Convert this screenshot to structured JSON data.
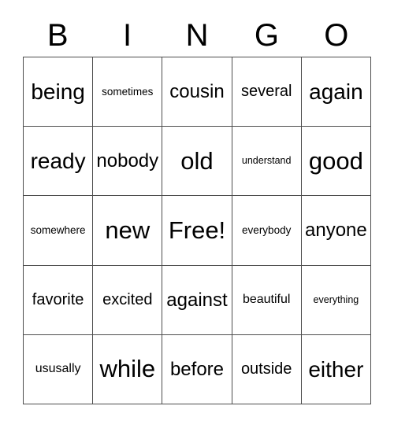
{
  "card": {
    "header_letters": [
      "B",
      "I",
      "N",
      "G",
      "O"
    ],
    "grid_rows": [
      [
        {
          "text": "being",
          "size": "lg"
        },
        {
          "text": "sometimes",
          "size": "xxs"
        },
        {
          "text": "cousin",
          "size": "md"
        },
        {
          "text": "several",
          "size": "sm"
        },
        {
          "text": "again",
          "size": "lg"
        }
      ],
      [
        {
          "text": "ready",
          "size": "lg"
        },
        {
          "text": "nobody",
          "size": "md"
        },
        {
          "text": "old",
          "size": "xl"
        },
        {
          "text": "understand",
          "size": "tiny"
        },
        {
          "text": "good",
          "size": "xl"
        }
      ],
      [
        {
          "text": "somewhere",
          "size": "xxs"
        },
        {
          "text": "new",
          "size": "xl"
        },
        {
          "text": "Free!",
          "size": "xl"
        },
        {
          "text": "everybody",
          "size": "xxs"
        },
        {
          "text": "anyone",
          "size": "md"
        }
      ],
      [
        {
          "text": "favorite",
          "size": "sm"
        },
        {
          "text": "excited",
          "size": "sm"
        },
        {
          "text": "against",
          "size": "md"
        },
        {
          "text": "beautiful",
          "size": "xs"
        },
        {
          "text": "everything",
          "size": "tiny"
        }
      ],
      [
        {
          "text": "ususally",
          "size": "xs"
        },
        {
          "text": "while",
          "size": "xl"
        },
        {
          "text": "before",
          "size": "md"
        },
        {
          "text": "outside",
          "size": "sm"
        },
        {
          "text": "either",
          "size": "lg"
        }
      ]
    ],
    "colors": {
      "grid_line": "#4d4d4d",
      "cell_background": "#ffffff",
      "text": "#000000",
      "page_background": "#ffffff"
    }
  }
}
